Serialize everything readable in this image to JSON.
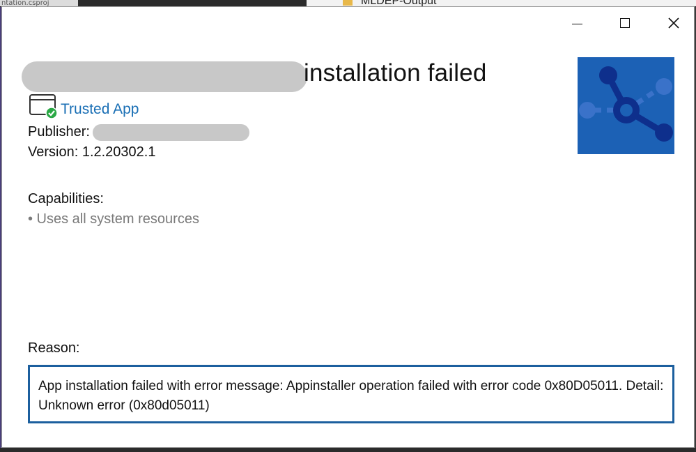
{
  "background": {
    "left_file_text": "ntation.csproj",
    "right_folder_text": "MLDEP-Output"
  },
  "window": {
    "caption_buttons": {
      "minimize": "minimize",
      "maximize": "maximize",
      "close": "✕"
    },
    "title_suffix": "installation failed",
    "trusted_label": "Trusted App",
    "publisher_label": "Publisher:",
    "version_text": "Version: 1.2.20302.1",
    "capabilities_label": "Capabilities:",
    "capabilities": [
      "• Uses all system resources"
    ],
    "reason_label": "Reason:",
    "error_message": "App installation failed with error message: Appinstaller operation failed with error code 0x80D05011. Detail: Unknown error (0x80d05011)"
  },
  "colors": {
    "accent": "#1a6fb5",
    "tile": "#1c61b5",
    "error_border": "#1c5f9e",
    "trusted_check": "#2aa845"
  },
  "icons": {
    "trusted": "trusted-app-shield-check-icon",
    "app_tile": "network-nodes-app-icon"
  }
}
